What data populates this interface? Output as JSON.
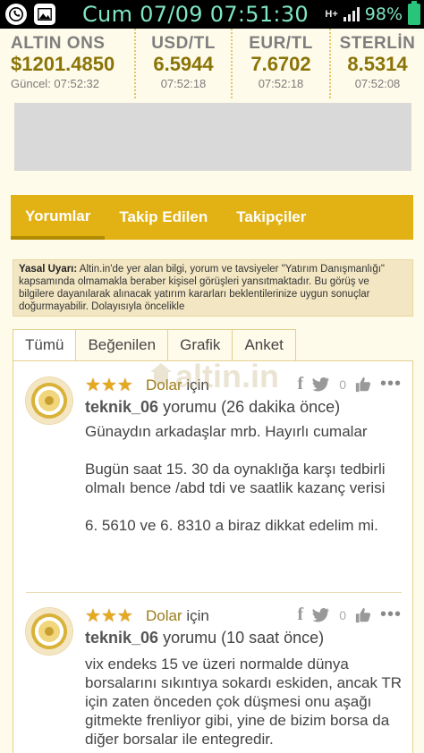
{
  "status_bar": {
    "carrier_date_time": "Cum 07/09 07:51:30",
    "network": "H+",
    "battery": "98%",
    "icons": [
      "whatsapp-icon",
      "gallery-icon"
    ]
  },
  "ticker": [
    {
      "name": "ALTIN ONS",
      "value": "$1201.4850",
      "updated": "Güncel: 07:52:32"
    },
    {
      "name": "USD/TL",
      "value": "6.5944",
      "updated": "07:52:18"
    },
    {
      "name": "EUR/TL",
      "value": "7.6702",
      "updated": "07:52:18"
    },
    {
      "name": "STERLİN",
      "value": "8.5314",
      "updated": "07:52:08"
    }
  ],
  "profile_tabs": [
    "Yorumlar",
    "Takip Edilen",
    "Takipçiler"
  ],
  "warning": {
    "title": "Yasal Uyarı:",
    "text": "Altin.in'de yer alan bilgi, yorum ve tavsiyeler \"Yatırım Danışmanlığı\" kapsamında olmamakla beraber kişisel görüşleri yansıtmaktadır. Bu görüş ve bilgilere dayanılarak alınacak yatırım kararları beklentilerinize uygun sonuçlar doğurmayabilir. Dolayısıyla öncelikle"
  },
  "filter_tabs": [
    "Tümü",
    "Beğenilen",
    "Grafik",
    "Anket"
  ],
  "watermark": "altin.in",
  "comments": [
    {
      "category": "Dolar",
      "category_suffix": "için",
      "user": "teknik_06",
      "meta": "yorumu (26 dakika önce)",
      "likes": "0",
      "stars": 3,
      "paragraphs": [
        "Günaydın arkadaşlar mrb. Hayırlı cumalar",
        "Bugün saat 15. 30 da oynaklığa karşı tedbirli olmalı bence /abd tdi ve saatlik kazanç verisi",
        "6. 5610 ve 6. 8310 a biraz dikkat edelim mi."
      ]
    },
    {
      "category": "Dolar",
      "category_suffix": "için",
      "user": "teknik_06",
      "meta": "yorumu (10 saat önce)",
      "likes": "0",
      "stars": 3,
      "paragraphs": [
        "vix endeks 15 ve üzeri normalde dünya borsalarını sıkıntıya sokardı eskiden, ancak TR için zaten önceden çok düşmesi onu aşağı gitmekte frenliyor gibi, yine de bizim borsa da diğer borsalar ile entegredir."
      ]
    }
  ],
  "colors": {
    "accent": "#e2b114",
    "value_gold": "#8a7408",
    "background": "#fffbea"
  }
}
